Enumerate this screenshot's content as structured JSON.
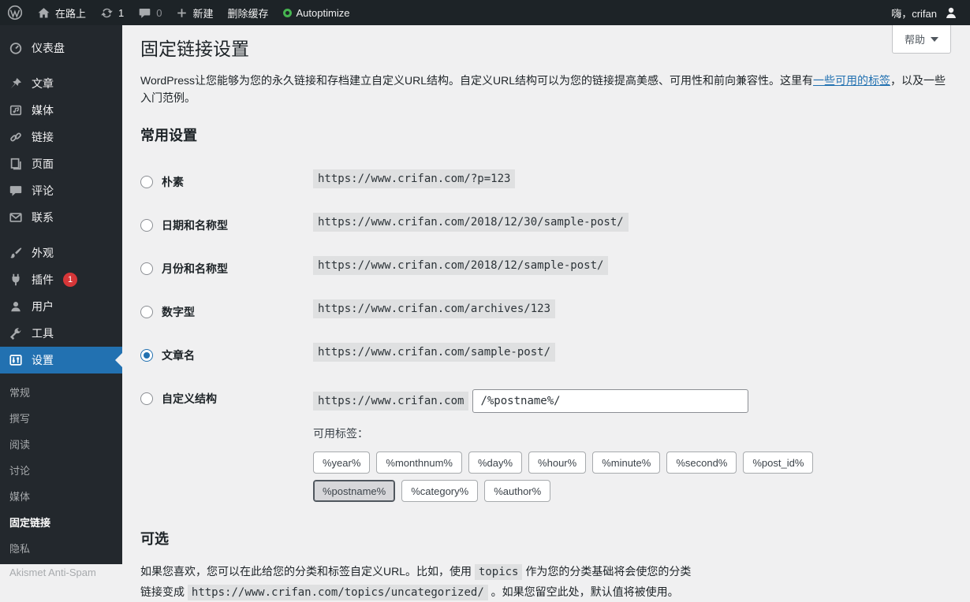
{
  "colors": {
    "admin_bar_bg": "#1d2327",
    "sidebar_bg": "#23282d",
    "accent_blue": "#2271b1",
    "badge_red": "#d63638",
    "autoptimize_green": "#46b450",
    "content_bg": "#f0f0f1",
    "code_bg": "#dfe0e1"
  },
  "admin_bar": {
    "site_name": "在路上",
    "update_count": "1",
    "comment_count": "0",
    "new_label": "新建",
    "clear_cache_label": "删除缓存",
    "autoptimize_label": "Autoptimize",
    "greeting": "嗨，crifan"
  },
  "sidebar": {
    "items": [
      {
        "label": "仪表盘"
      },
      {
        "label": "文章"
      },
      {
        "label": "媒体"
      },
      {
        "label": "链接"
      },
      {
        "label": "页面"
      },
      {
        "label": "评论"
      },
      {
        "label": "联系"
      },
      {
        "label": "外观"
      },
      {
        "label": "插件",
        "badge": "1"
      },
      {
        "label": "用户"
      },
      {
        "label": "工具"
      },
      {
        "label": "设置"
      }
    ],
    "settings_submenu": [
      {
        "label": "常规"
      },
      {
        "label": "撰写"
      },
      {
        "label": "阅读"
      },
      {
        "label": "讨论"
      },
      {
        "label": "媒体"
      },
      {
        "label": "固定链接"
      },
      {
        "label": "隐私"
      },
      {
        "label": "Akismet Anti-Spam"
      }
    ]
  },
  "page": {
    "help_label": "帮助",
    "title": "固定链接设置",
    "intro_before_link": "WordPress让您能够为您的永久链接和存档建立自定义URL结构。自定义URL结构可以为您的链接提高美感、可用性和前向兼容性。这里有",
    "intro_link": "一些可用的标签",
    "intro_after_link": "，以及一些入门范例。",
    "common_settings_title": "常用设置",
    "options": [
      {
        "label": "朴素",
        "url": "https://www.crifan.com/?p=123"
      },
      {
        "label": "日期和名称型",
        "url": "https://www.crifan.com/2018/12/30/sample-post/"
      },
      {
        "label": "月份和名称型",
        "url": "https://www.crifan.com/2018/12/sample-post/"
      },
      {
        "label": "数字型",
        "url": "https://www.crifan.com/archives/123"
      },
      {
        "label": "文章名",
        "url": "https://www.crifan.com/sample-post/"
      },
      {
        "label": "自定义结构",
        "url_prefix": "https://www.crifan.com",
        "input_value": "/%postname%/"
      }
    ],
    "selected_option": "文章名",
    "available_tags_label": "可用标签：",
    "tags": [
      "%year%",
      "%monthnum%",
      "%day%",
      "%hour%",
      "%minute%",
      "%second%",
      "%post_id%",
      "%postname%",
      "%category%",
      "%author%"
    ],
    "active_tag": "%postname%",
    "optional_title": "可选",
    "optional_text_1": "如果您喜欢，您可以在此给您的分类和标签自定义URL。比如，使用",
    "optional_code_1": "topics",
    "optional_text_2": "作为您的分类基础将会使您的分类链接变成",
    "optional_code_2": "https://www.crifan.com/topics/uncategorized/",
    "optional_text_3": "。如果您留空此处，默认值将被使用。"
  }
}
